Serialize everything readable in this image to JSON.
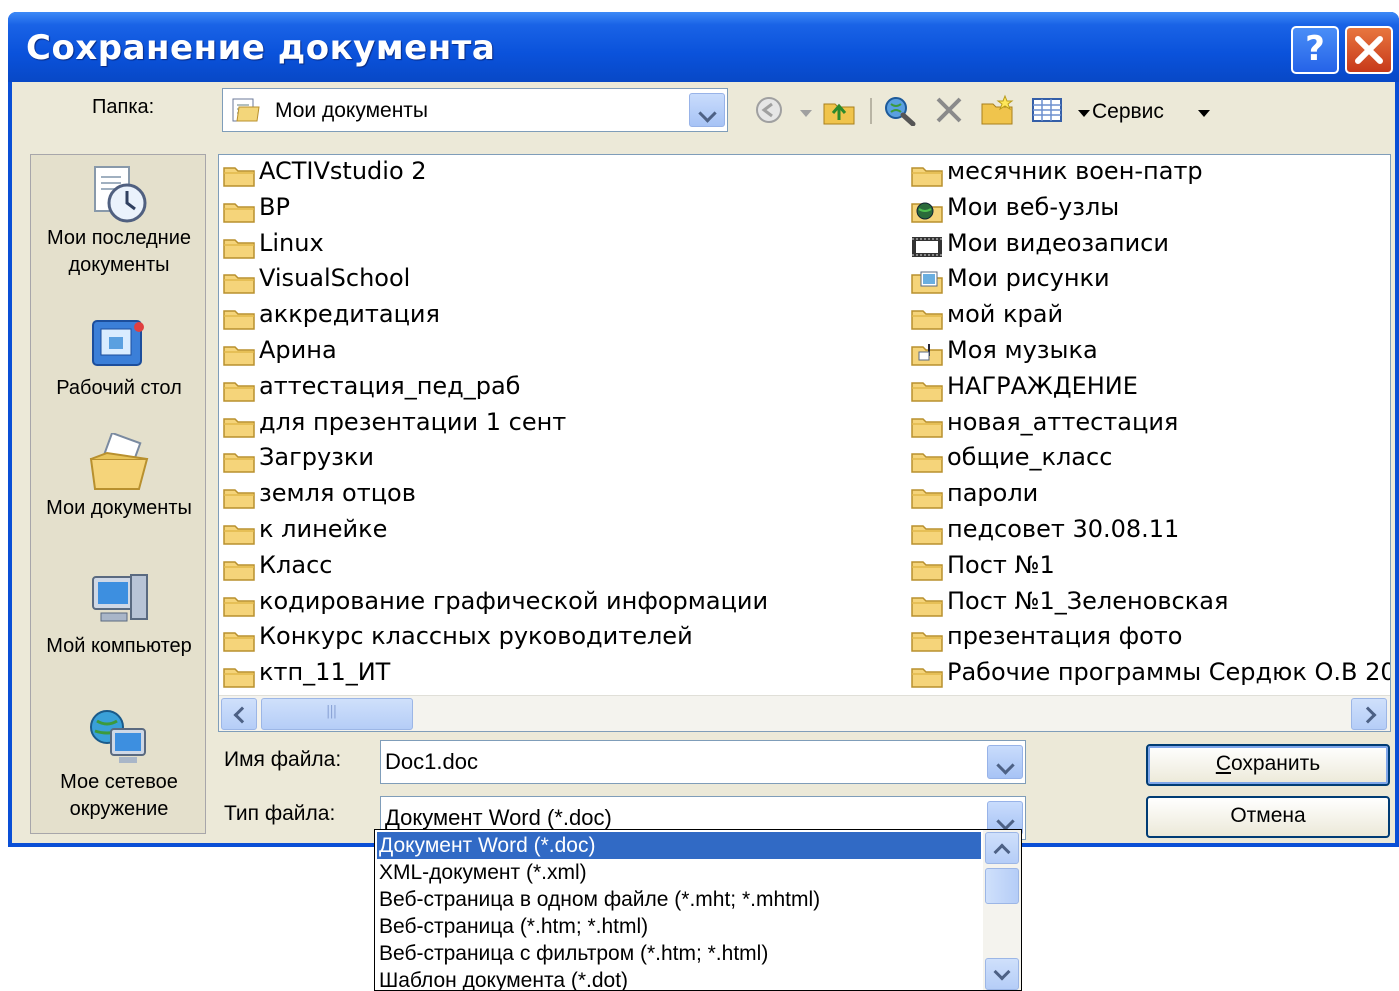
{
  "window": {
    "title": "Сохранение документа",
    "help_label": "?",
    "close_label": "✕"
  },
  "toolbar": {
    "folder_label": "Папка:",
    "folder_value": "Мои документы",
    "service_label": "Сервис",
    "icons": [
      "back-icon",
      "up-folder-icon",
      "web-search-icon",
      "delete-icon",
      "new-folder-icon",
      "views-icon"
    ]
  },
  "places": [
    {
      "label": "Мои последние документы",
      "icon": "recent-documents-icon"
    },
    {
      "label": "Рабочий стол",
      "icon": "desktop-icon"
    },
    {
      "label": "Мои документы",
      "icon": "my-documents-icon"
    },
    {
      "label": "Мой компьютер",
      "icon": "my-computer-icon"
    },
    {
      "label": "Мое сетевое окружение",
      "icon": "network-places-icon"
    }
  ],
  "files": {
    "col1": [
      {
        "name": "ACTIVstudio 2",
        "icon": "folder"
      },
      {
        "name": "BP",
        "icon": "folder"
      },
      {
        "name": "Linux",
        "icon": "folder"
      },
      {
        "name": "VisualSchool",
        "icon": "folder"
      },
      {
        "name": "аккредитация",
        "icon": "folder"
      },
      {
        "name": "Арина",
        "icon": "folder"
      },
      {
        "name": "аттестация_пед_раб",
        "icon": "folder"
      },
      {
        "name": "для презентации 1 сент",
        "icon": "folder"
      },
      {
        "name": "Загрузки",
        "icon": "folder"
      },
      {
        "name": "земля отцов",
        "icon": "folder"
      },
      {
        "name": "к линейке",
        "icon": "folder"
      },
      {
        "name": "Класс",
        "icon": "folder"
      },
      {
        "name": "кодирование графической информации",
        "icon": "folder"
      },
      {
        "name": "Конкурс классных руководителей",
        "icon": "folder"
      },
      {
        "name": "ктп_11_ИТ",
        "icon": "folder"
      }
    ],
    "col2": [
      {
        "name": "месячник воен-патр",
        "icon": "folder"
      },
      {
        "name": "Мои веб-узлы",
        "icon": "web-folder"
      },
      {
        "name": "Мои видеозаписи",
        "icon": "video-folder"
      },
      {
        "name": "Мои рисунки",
        "icon": "pictures-folder"
      },
      {
        "name": "мой край",
        "icon": "folder"
      },
      {
        "name": "Моя музыка",
        "icon": "music-folder"
      },
      {
        "name": "НАГРАЖДЕНИЕ",
        "icon": "folder"
      },
      {
        "name": "новая_аттестация",
        "icon": "folder"
      },
      {
        "name": "общие_класс",
        "icon": "folder"
      },
      {
        "name": "пароли",
        "icon": "folder"
      },
      {
        "name": "педсовет 30.08.11",
        "icon": "folder"
      },
      {
        "name": "Пост №1",
        "icon": "folder"
      },
      {
        "name": "Пост №1_Зеленовская",
        "icon": "folder"
      },
      {
        "name": "презентация фото",
        "icon": "folder"
      },
      {
        "name": "Рабочие программы Сердюк О.В 20",
        "icon": "folder"
      }
    ]
  },
  "form": {
    "filename_label": "Имя файла:",
    "filename_value": "Doc1.doc",
    "filetype_label": "Тип файла:",
    "filetype_value": "Документ Word (*.doc)",
    "save_label_rest": "охранить",
    "save_label_access": "С",
    "cancel_label": "Отмена"
  },
  "filetype_options": [
    "Документ Word (*.doc)",
    "XML-документ (*.xml)",
    "Веб-страница в одном файле (*.mht; *.mhtml)",
    "Веб-страница (*.htm; *.html)",
    "Веб-страница с фильтром (*.htm; *.html)",
    "Шаблон документа (*.dot)"
  ],
  "colors": {
    "titlebar": "#0a52db",
    "dialog_bg": "#ece9d8",
    "selection": "#316ac5"
  }
}
